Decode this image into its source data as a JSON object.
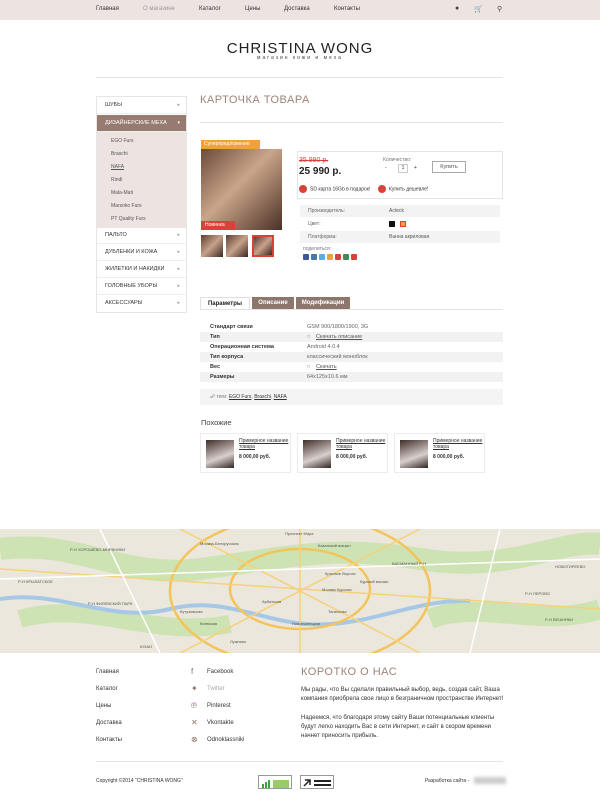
{
  "topnav": {
    "items": [
      "Главная",
      "О магазине",
      "Каталог",
      "Цены",
      "Доставка",
      "Контакты"
    ],
    "active_index": 1
  },
  "topicons": [
    "user-icon",
    "cart-icon",
    "search-icon"
  ],
  "brand": {
    "title": "CHRISTINA WONG",
    "subtitle": "магазин кожи и меха"
  },
  "sidebar": {
    "items": [
      {
        "label": "ШУБЫ"
      },
      {
        "label": "ДИЗАЙНЕРСКИЕ МЕХА"
      },
      {
        "label": "ПАЛЬТО"
      },
      {
        "label": "ДУБЛЕНКИ И КОЖА"
      },
      {
        "label": "ЖИЛЕТКИ И НАКИДКИ"
      },
      {
        "label": "ГОЛОВНЫЕ УБОРЫ"
      },
      {
        "label": "АКСЕССУАРЫ"
      }
    ],
    "active_index": 1,
    "sub_items": [
      "EGO Furs",
      "Braschi",
      "NAFA",
      "Rindi",
      "Mala-Mati",
      "Marsoko Furs",
      "PT Quality Furs"
    ]
  },
  "product": {
    "page_title": "КАРТОЧКА ТОВАРА",
    "badge_top": "Суперпредложение",
    "badge_new": "Новинка",
    "old_price": "35 990 р.",
    "price": "25 990 р.",
    "qty_label": "Количество:",
    "qty_minus": "-",
    "qty_value": "1",
    "qty_plus": "+",
    "buy_label": "Купить",
    "promo1": "SD карта 16Gb в подарок!",
    "promo2": "Купить дешевле!",
    "specs": [
      {
        "key": "Производитель:",
        "value": "Acteck"
      },
      {
        "key": "Цвет:",
        "value": ""
      },
      {
        "key": "Платформа:",
        "value": "Ванна акриловая"
      }
    ],
    "colors": [
      "#111111",
      "#f0a13a"
    ],
    "share_label": "поделиться:",
    "share_colors": [
      "#3b5998",
      "#4a76a8",
      "#55acee",
      "#f0a13a",
      "#d9413b",
      "#3c8b5a",
      "#d9413b"
    ]
  },
  "tabs": [
    "Параметры",
    "Описание",
    "Модификации"
  ],
  "params": [
    {
      "key": "Стандарт связи",
      "value": "GSM 900/1800/1900, 3G"
    },
    {
      "key": "Тип",
      "value": "Скачать описание"
    },
    {
      "key": "Операционная система",
      "value": "Android 4.0.4"
    },
    {
      "key": "Тип корпуса",
      "value": "классический моноблок"
    },
    {
      "key": "Вес",
      "value": "Скачать"
    },
    {
      "key": "Размеры",
      "value": "64х125х10.6 мм"
    }
  ],
  "tags": {
    "label": "теги:",
    "items": [
      "EGO Furs",
      "Braschi",
      "NAFA"
    ]
  },
  "similar": {
    "title": "Похожие",
    "items": [
      {
        "name": "Примерное название товара",
        "price": "8 000,00 руб."
      },
      {
        "name": "Примерное название товара",
        "price": "8 000,00 руб."
      },
      {
        "name": "Примерное название товара",
        "price": "8 000,00 руб."
      }
    ]
  },
  "map_labels": [
    "Москва-Белорусская",
    "Проспект Мира",
    "Казанский вокзал",
    "Красные Ворота",
    "Курский вокзал",
    "Москва Курская",
    "Таганская",
    "Новокузнецкая",
    "Кутузовская",
    "Киевская",
    "Лужники",
    "Арбатская",
    "ЮЗАО",
    "Р-Н ФИЛЕВСКИЙ ПАРК",
    "Р-Н ПЕРОВО",
    "Р-Н ХОРОШЁВО-МНЁВНИКИ",
    "Р-Н КРЫЛАТСКОЕ",
    "БАСМАННЫЙ Р-Н",
    "НОВОГИРЕЕВО",
    "Р-Н ВЕШНЯКИ"
  ],
  "footer": {
    "links": [
      "Главная",
      "Каталог",
      "Цены",
      "Доставка",
      "Контакты"
    ],
    "social": [
      {
        "icon": "facebook-icon",
        "glyph": "f",
        "label": "Facebook"
      },
      {
        "icon": "twitter-icon",
        "glyph": "✦",
        "label": "Twitter"
      },
      {
        "icon": "pinterest-icon",
        "glyph": "℗",
        "label": "Pinterest"
      },
      {
        "icon": "vkontakte-icon",
        "glyph": "✕",
        "label": "Vkontakte"
      },
      {
        "icon": "odnoklassniki-icon",
        "glyph": "⊗",
        "label": "Odnoklassniki"
      }
    ],
    "about_title": "КОРОТКО О НАС",
    "about_p1": "Мы рады, что Вы сделали правильный выбор, ведь, создав сайт, Ваша компания приобрела свое лицо в безграничном пространстве Интернет!",
    "about_p2": "Надеемся, что благодаря этому сайту Ваши потенциальные клиенты будут легко находить Вас в сети Интернет, и сайт в скором времени начнет приносить прибыль.",
    "copyright": "Copyright ©2014 \"CHRISTINA WONG\"",
    "developer": "Разработка сайта -"
  }
}
